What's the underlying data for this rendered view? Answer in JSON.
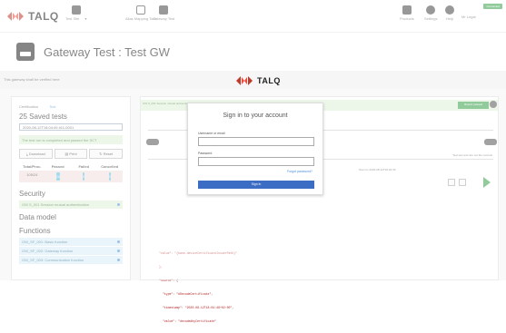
{
  "app": {
    "brand": "TALQ"
  },
  "nav": {
    "selector_label": "Test Site",
    "items": [
      {
        "label": "Alias Mapping Tool",
        "icon": "people-icon"
      },
      {
        "label": "Gateway Test",
        "icon": "gateway-icon"
      },
      {
        "label": "Products",
        "icon": "products-icon"
      },
      {
        "label": "Settings",
        "icon": "gear-icon"
      },
      {
        "label": "Help",
        "icon": "help-icon"
      },
      {
        "label": "Mr Legal",
        "icon": "user-icon"
      }
    ],
    "badge": "Connected"
  },
  "page": {
    "title": "Gateway Test : Test GW",
    "subtitle": "This gateway shall be verified here"
  },
  "left": {
    "tabs": [
      "Certification",
      "Test"
    ],
    "saved_count": "25 Saved tests",
    "selected_test": "2020-08-12T18:04:49 #11-0001",
    "status_msg": "The test run is completed and passed the SCT",
    "buttons": {
      "download": "Download",
      "print": "Print",
      "reset": "Reset"
    },
    "table": {
      "headers": [
        "Total/Proc.",
        "Passed",
        "Failed",
        "Cancelled"
      ],
      "row": [
        "105/24",
        "24",
        "0",
        "0"
      ]
    },
    "security_title": "Security",
    "security_items": [
      "GW S_001 Session mutual authentication"
    ],
    "data_model_title": "Data model",
    "functions_title": "Functions",
    "function_items": [
      "GW_SF_001: Basic function",
      "GW_SF_002: Gateway function",
      "GW_SF_003: Communication function"
    ]
  },
  "right": {
    "banner": "GW S_001 Session mutual authentication",
    "banner_btn": "Result: passed",
    "hint": "Test test and dev out file controls",
    "timestamp": "Test run 2020-08-12T18:04:49",
    "code_lines": [
      "\"value\": \"{base.deviceCertificateIssuerPath}\"",
      "},",
      "\"source\": {",
      "  \"type\": \"#DecodeCertificate\",",
      "  \"timestamp\": \"2020-08-12T18:04:49+02:00\",",
      "  \"value\": \"decodedbyCertificate\""
    ]
  },
  "modal": {
    "title": "Sign in to your account",
    "username_label": "Username or email",
    "password_label": "Password",
    "forgot_link": "Forgot password?",
    "submit_label": "Sign in"
  }
}
